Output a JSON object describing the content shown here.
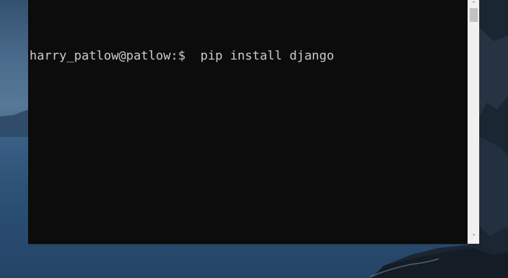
{
  "terminal": {
    "prompt": "harry_patlow@patlow:$",
    "command": "  pip install django"
  },
  "scrollbar": {
    "up_arrow_icon": "chevron-up-icon",
    "down_arrow_icon": "chevron-down-icon",
    "up_glyph": "˄",
    "down_glyph": "˅"
  },
  "colors": {
    "terminal_background": "#0c0c0c",
    "terminal_text": "#cccccc",
    "scrollbar_track": "#f0f0f0",
    "scrollbar_thumb": "#c2c2c2"
  }
}
